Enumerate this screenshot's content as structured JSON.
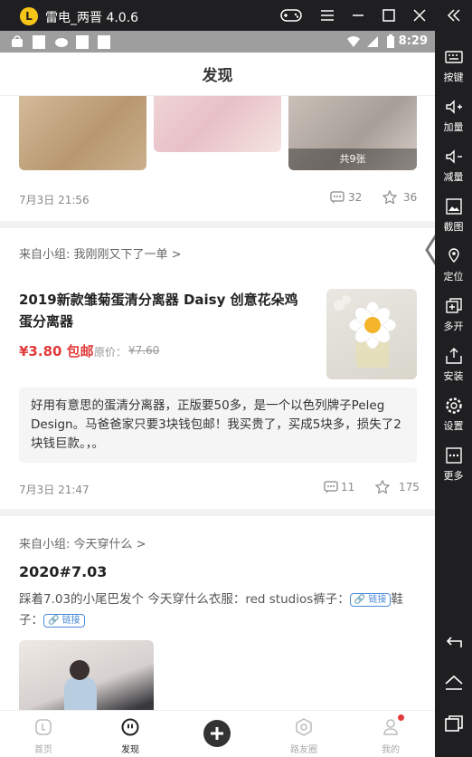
{
  "window": {
    "title": "雷电_两晋 4.0.6"
  },
  "statusbar": {
    "time": "8:29"
  },
  "header": {
    "title": "发现"
  },
  "post1": {
    "photo_count": "共9张",
    "date": "7月3日 21:56",
    "comments": "32",
    "likes": "36"
  },
  "post2": {
    "group": "来自小组: 我刚刚又下了一单 >",
    "product_title": "2019新款雏菊蛋清分离器 Daisy 创意花朵鸡蛋分离器",
    "price": "¥3.80 包邮",
    "orig_label": "原价：",
    "orig_price": "¥7.60",
    "quote": "好用有意思的蛋清分离器，正版要50多，是一个以色列牌子Peleg Design。马爸爸家只要3块钱包邮！我买贵了，买成5块多，损失了2块钱巨款。，。",
    "date": "7月3日 21:47",
    "comments": "11",
    "likes": "175"
  },
  "post3": {
    "group": "来自小组: 今天穿什么 >",
    "title": "2020#7.03",
    "text_a": "踩着7.03的小尾巴发个 今天穿什么衣服：red studios裤子：",
    "link1": "🔗 链接",
    "text_b": "鞋子：",
    "link2": "🔗 链接"
  },
  "tabs": [
    {
      "label": "首页"
    },
    {
      "label": "发现"
    },
    {
      "label": ""
    },
    {
      "label": "路友圈"
    },
    {
      "label": "我的"
    }
  ],
  "sidebar": [
    {
      "label": "按键"
    },
    {
      "label": "加量"
    },
    {
      "label": "减量"
    },
    {
      "label": "截图"
    },
    {
      "label": "定位"
    },
    {
      "label": "多开"
    },
    {
      "label": "安装"
    },
    {
      "label": "设置"
    },
    {
      "label": "更多"
    }
  ],
  "colors": {
    "accent_red": "#e23a3a",
    "link_blue": "#4a8ad8",
    "chrome": "#1f1f21"
  }
}
